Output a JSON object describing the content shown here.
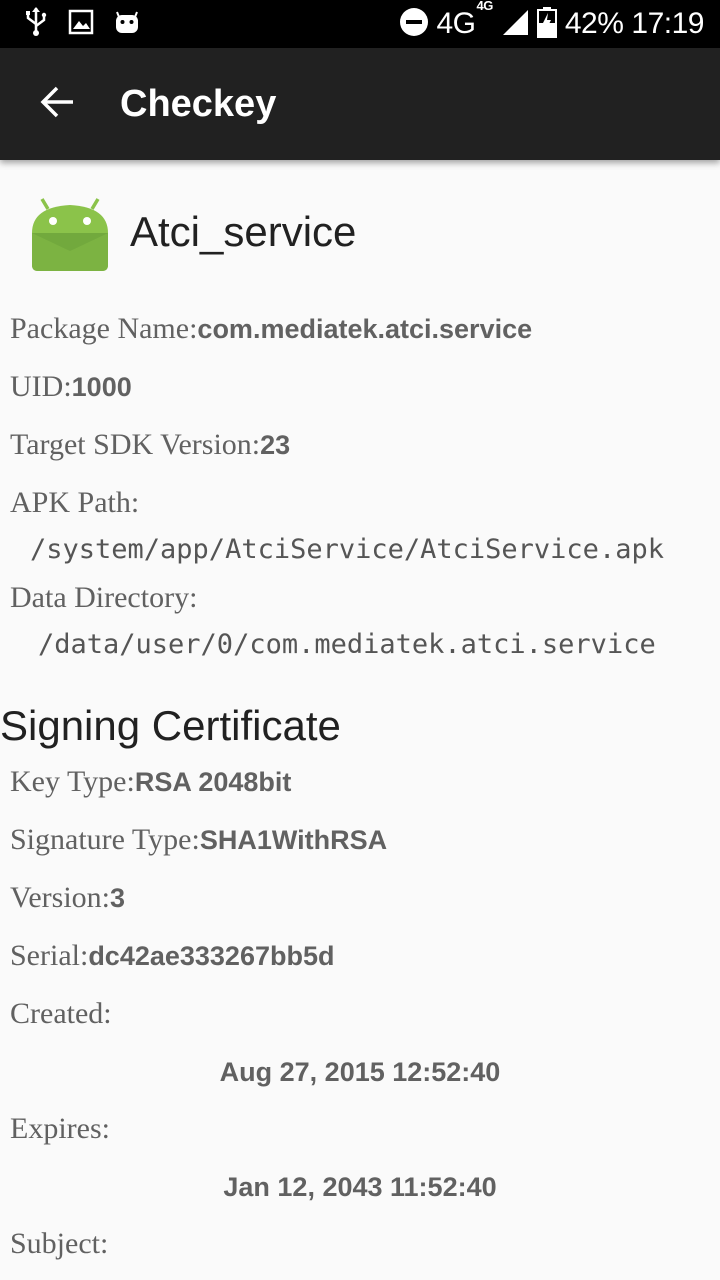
{
  "status_bar": {
    "icons": [
      "usb-icon",
      "image-icon",
      "android-icon",
      "do-not-disturb-icon",
      "signal-icon",
      "battery-icon"
    ],
    "network": "4G",
    "network_sup": "4G",
    "battery": "42%",
    "time": "17:19"
  },
  "app_bar": {
    "title": "Checkey",
    "back_icon": "arrow-back-icon"
  },
  "app": {
    "name": "Atci_service",
    "icon": "android-app-icon"
  },
  "details": {
    "package_label": "Package Name:",
    "package_value": "com.mediatek.atci.service",
    "uid_label": "UID:",
    "uid_value": "1000",
    "sdk_label": "Target SDK Version:",
    "sdk_value": "23",
    "apk_label": "APK Path:",
    "apk_value": "/system/app/AtciService/AtciService.apk",
    "data_label": "Data Directory:",
    "data_value": "/data/user/0/com.mediatek.atci.service"
  },
  "certificate": {
    "section_title": "Signing Certificate",
    "key_label": "Key Type:",
    "key_value": "RSA 2048bit",
    "sig_label": "Signature Type:",
    "sig_value": "SHA1WithRSA",
    "version_label": "Version:",
    "version_value": "3",
    "serial_label": "Serial:",
    "serial_value": "dc42ae333267bb5d",
    "created_label": "Created:",
    "created_value": "Aug 27, 2015 12:52:40",
    "expires_label": "Expires:",
    "expires_value": "Jan 12, 2043 11:52:40",
    "subject_label": "Subject:"
  },
  "colors": {
    "status_bar": "#000000",
    "app_bar": "#212121",
    "background": "#fafafa",
    "android_green": "#8bc34a"
  }
}
